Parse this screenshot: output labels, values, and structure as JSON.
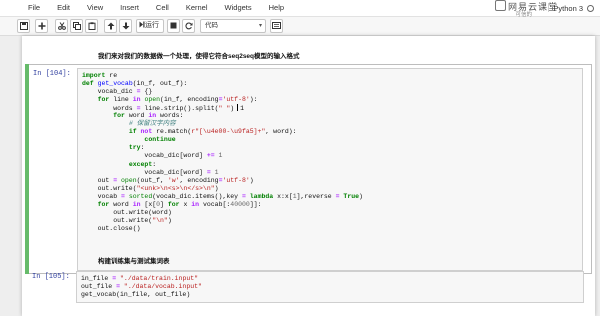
{
  "menubar": {
    "items": [
      "File",
      "Edit",
      "View",
      "Insert",
      "Cell",
      "Kernel",
      "Widgets",
      "Help"
    ],
    "brand": "网易云课堂",
    "trusted": "可信的",
    "kernel": "Python 3"
  },
  "toolbar": {
    "run_label": "运行",
    "cell_type": "代码"
  },
  "cells": [
    {
      "type": "markdown",
      "text": "我们来对我们的数据做一个处理，使得它符合seq2seq模型的输入格式"
    },
    {
      "type": "code",
      "prompt": "In [104]:",
      "lines": [
        "import re",
        "def get_vocab(in_f, out_f):",
        "    vocab_dic = {}",
        "    for line in open(in_f, encoding='utf-8'):",
        "        words = line.strip().split(\" \")",
        "        for word in words:",
        "            # 保留汉字内容",
        "            if not re.match(r\"[\\u4e00-\\u9fa5]+\", word):",
        "                continue",
        "            try:",
        "                vocab_dic[word] += 1",
        "            except:",
        "                vocab_dic[word] = 1",
        "    out = open(out_f, 'w', encoding='utf-8')",
        "    out.write(\"<unk>\\n<s>\\n</s>\\n\")",
        "    vocab = sorted(vocab_dic.items(),key = lambda x:x[1],reverse = True)",
        "    for word in [x[0] for x in vocab[:40000]]:",
        "        out.write(word)",
        "        out.write(\"\\n\")",
        "    out.close()"
      ],
      "cursor_line": 4,
      "cursor_trailing_text": "1"
    },
    {
      "type": "markdown",
      "text": "构建训练集与测试集词表"
    },
    {
      "type": "code",
      "prompt": "In [105]:",
      "lines": [
        "in_file = \"./data/train.input\"",
        "out_file = \"./data/vocab.input\"",
        "get_vocab(in_file, out_file)"
      ]
    }
  ]
}
